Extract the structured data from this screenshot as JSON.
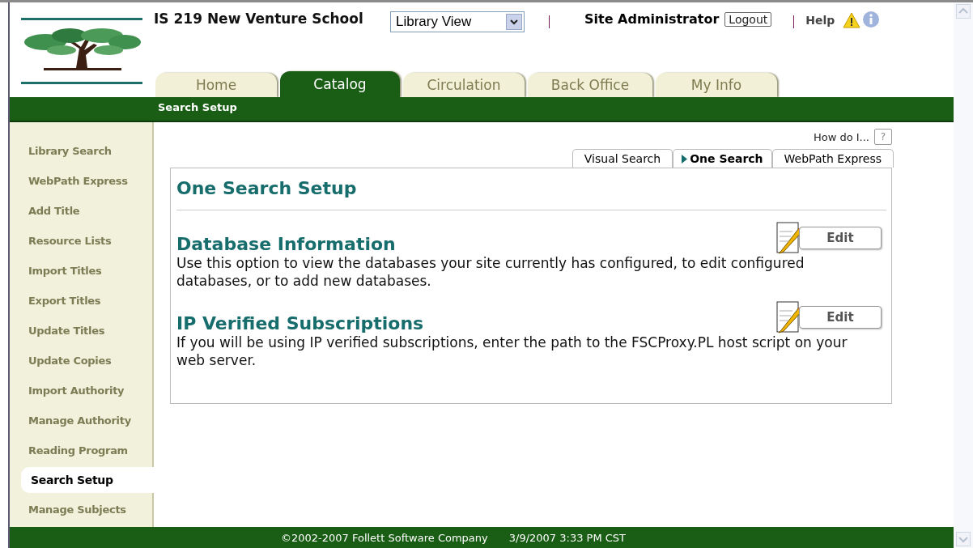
{
  "school": "IS 219 New Venture School",
  "view_select": {
    "value": "Library View"
  },
  "user": "Site Administrator",
  "logout": "Logout",
  "help": "Help",
  "main_tabs": [
    {
      "label": "Home",
      "selected": false
    },
    {
      "label": "Catalog",
      "selected": true
    },
    {
      "label": "Circulation",
      "selected": false
    },
    {
      "label": "Back Office",
      "selected": false
    },
    {
      "label": "My Info",
      "selected": false
    }
  ],
  "subnav": "Search Setup",
  "sidebar": {
    "items": [
      {
        "label": "Library Search",
        "selected": false
      },
      {
        "label": "WebPath Express",
        "selected": false
      },
      {
        "label": "Add Title",
        "selected": false
      },
      {
        "label": "Resource Lists",
        "selected": false
      },
      {
        "label": "Import Titles",
        "selected": false
      },
      {
        "label": "Export Titles",
        "selected": false
      },
      {
        "label": "Update Titles",
        "selected": false
      },
      {
        "label": "Update Copies",
        "selected": false
      },
      {
        "label": "Import Authority",
        "selected": false
      },
      {
        "label": "Manage Authority",
        "selected": false
      },
      {
        "label": "Reading Program",
        "selected": false
      },
      {
        "label": "Search Setup",
        "selected": true
      },
      {
        "label": "Manage Subjects",
        "selected": false
      }
    ]
  },
  "how_do_i": "How do I...",
  "help_box": "?",
  "sub_tabs": [
    {
      "label": "Visual Search",
      "selected": false
    },
    {
      "label": "One Search",
      "selected": true
    },
    {
      "label": "WebPath Express",
      "selected": false
    }
  ],
  "page_title": "One Search Setup",
  "sections": [
    {
      "title": "Database Information",
      "description": "Use this option to view the databases your site currently has configured, to edit configured databases, or to add new databases.",
      "button": "Edit"
    },
    {
      "title": "IP Verified Subscriptions",
      "description": "If you will be using IP verified subscriptions, enter the path to the FSCProxy.PL host script on your web server.",
      "button": "Edit"
    }
  ],
  "footer": {
    "copyright": "©2002-2007  Follett Software Company",
    "datetime": "3/9/2007 3:33 PM CST"
  }
}
